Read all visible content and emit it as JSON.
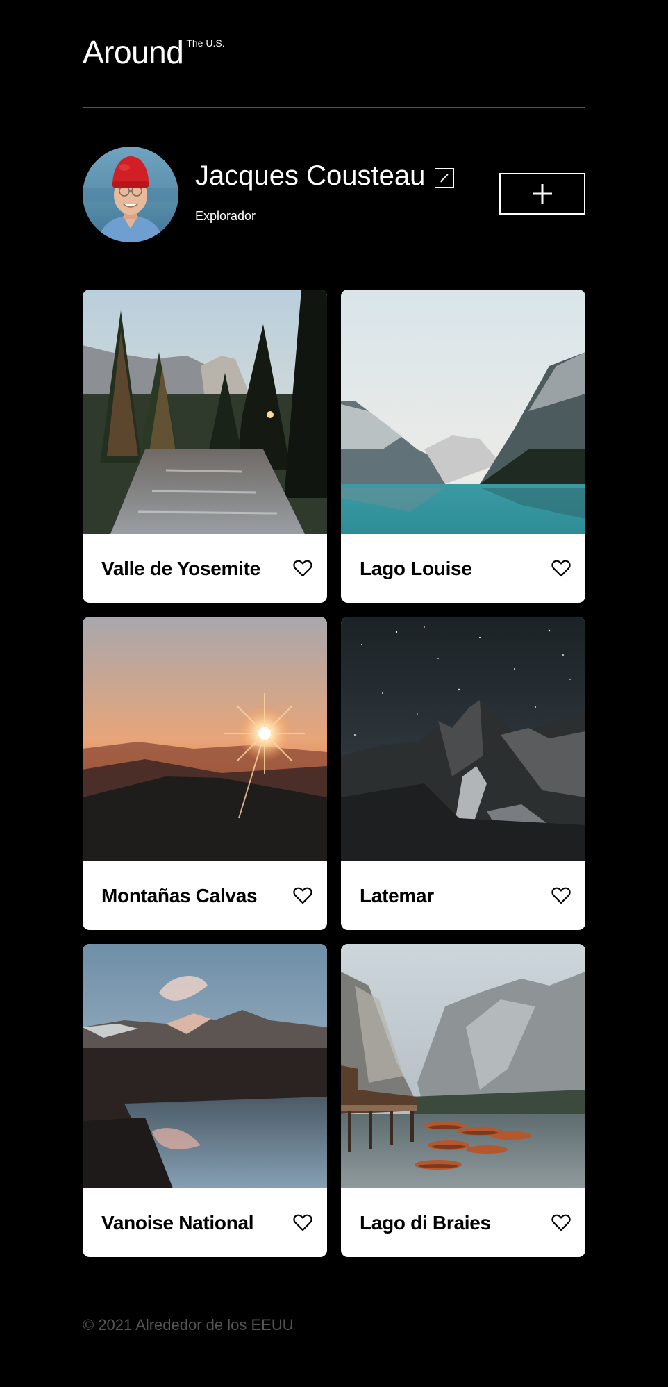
{
  "header": {
    "logo_word": "Around",
    "logo_sup": "The U.S."
  },
  "profile": {
    "name": "Jacques Cousteau",
    "role": "Explorador",
    "icons": {
      "edit": "pencil-icon",
      "add": "plus-icon"
    }
  },
  "cards": [
    {
      "title": "Valle de Yosemite",
      "scene": "forest-river"
    },
    {
      "title": "Lago Louise",
      "scene": "glacier-lake"
    },
    {
      "title": "Montañas Calvas",
      "scene": "sunset-hills"
    },
    {
      "title": "Latemar",
      "scene": "night-mountains"
    },
    {
      "title": "Vanoise National",
      "scene": "mountain-lake-reflection"
    },
    {
      "title": "Lago di Braies",
      "scene": "dock-boats-lake"
    }
  ],
  "like_icon": "heart-outline-icon",
  "footer": {
    "copyright": "© 2021 Alrededor de los EEUU"
  },
  "colors": {
    "background": "#000000",
    "card": "#ffffff",
    "footer_text": "#545454",
    "divider": "#545454"
  }
}
